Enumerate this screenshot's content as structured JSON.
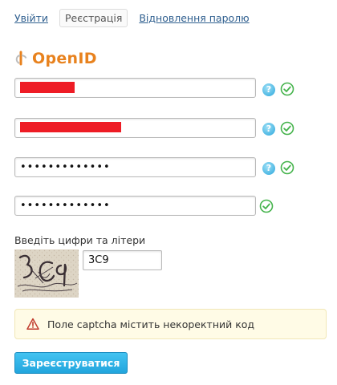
{
  "tabs": [
    {
      "label": "Увійти",
      "active": false
    },
    {
      "label": "Реєстрація",
      "active": true
    },
    {
      "label": "Відновлення паролю",
      "active": false
    }
  ],
  "openid": {
    "logo_text": "OpenID"
  },
  "form": {
    "password_mask": "•••••••••••••",
    "confirm_mask": "•••••••••••••"
  },
  "captcha": {
    "label": "Введіть цифри та літери",
    "value": "3C9"
  },
  "error": {
    "message": "Поле captcha містить некоректний код"
  },
  "submit": {
    "label": "Зареєструватися"
  },
  "colors": {
    "accent": "#22a5dd",
    "redaction": "#ee1c25",
    "valid": "#44b34b",
    "openid": "#e8821e"
  }
}
